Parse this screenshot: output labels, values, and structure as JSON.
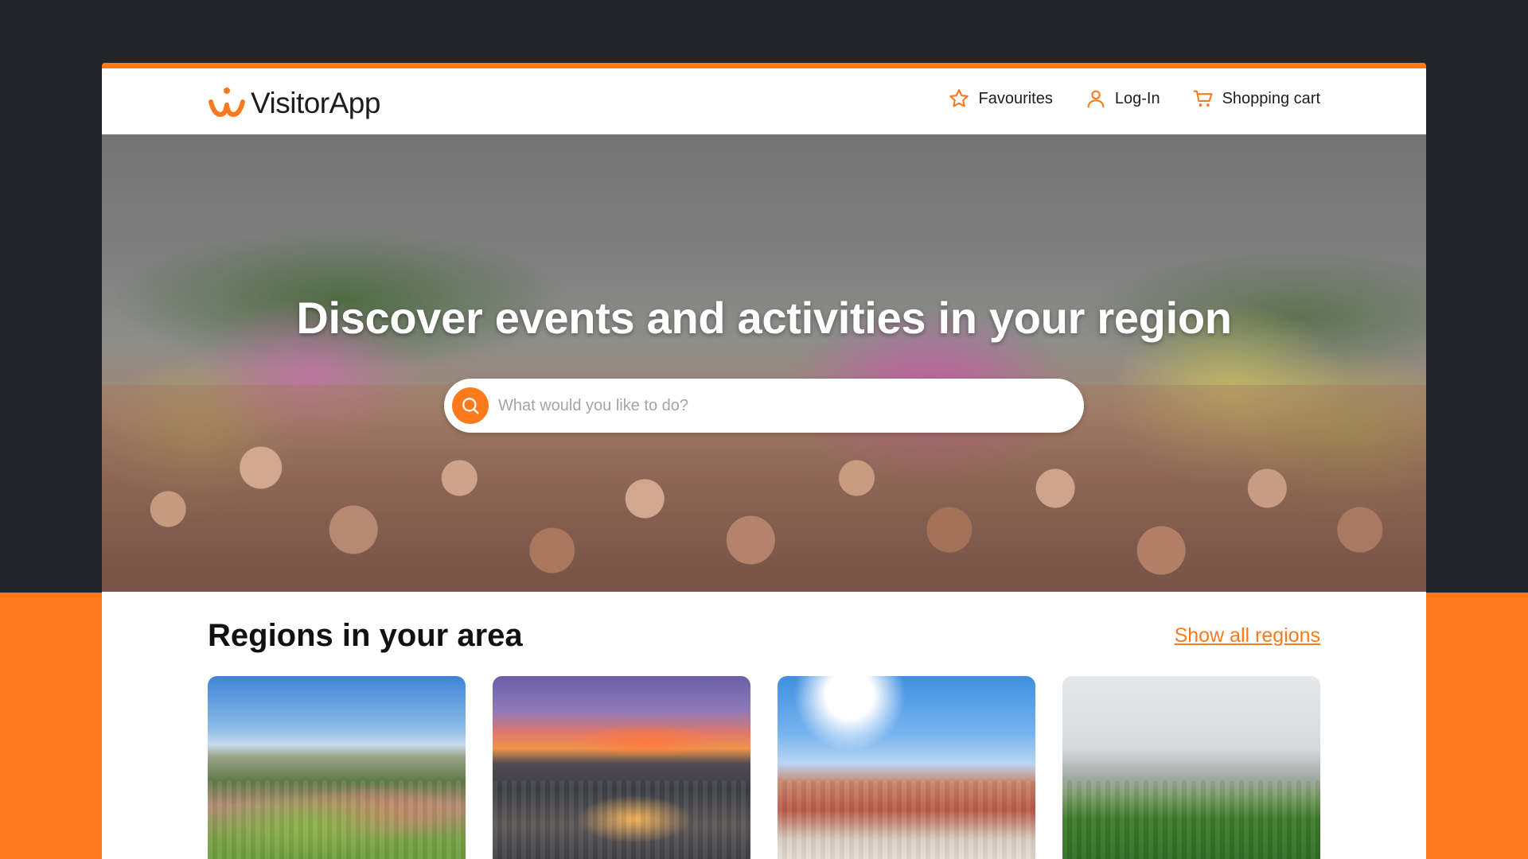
{
  "app": {
    "name": "VisitorApp",
    "accent_color": "#fd7a1c"
  },
  "header": {
    "logo_icon": "visitorapp-logo-icon",
    "nav": [
      {
        "label": "Favourites",
        "icon": "star-icon"
      },
      {
        "label": "Log-In",
        "icon": "user-icon"
      },
      {
        "label": "Shopping cart",
        "icon": "cart-icon"
      }
    ]
  },
  "hero": {
    "title": "Discover events and activities in your region",
    "search": {
      "placeholder": "What would you like to do?",
      "value": "",
      "icon": "search-icon"
    }
  },
  "regions": {
    "title": "Regions in your area",
    "show_all_label": "Show all regions",
    "cards": [
      {
        "image": "region-landscape-hills"
      },
      {
        "image": "region-sunset-valley"
      },
      {
        "image": "region-town-square-church"
      },
      {
        "image": "region-green-park"
      }
    ]
  }
}
